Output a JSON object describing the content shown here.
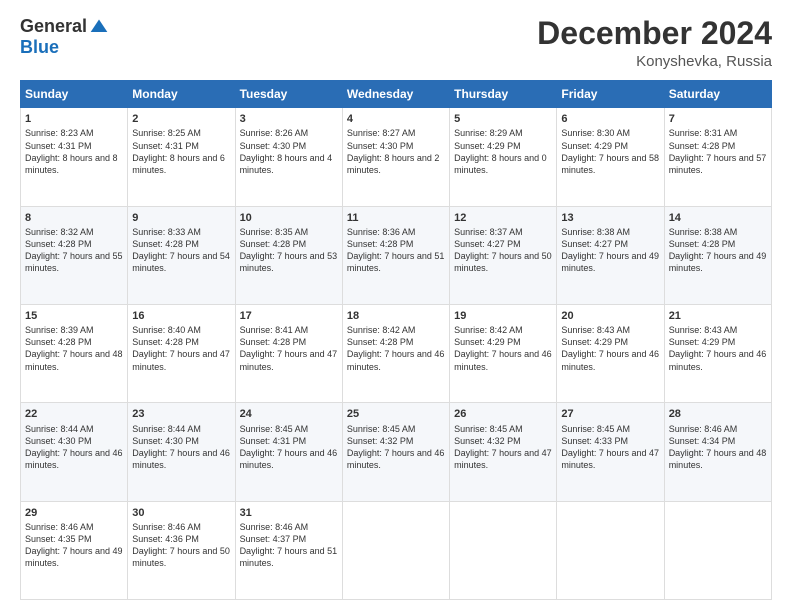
{
  "logo": {
    "general": "General",
    "blue": "Blue"
  },
  "title": {
    "month_year": "December 2024",
    "location": "Konyshevka, Russia"
  },
  "days_of_week": [
    "Sunday",
    "Monday",
    "Tuesday",
    "Wednesday",
    "Thursday",
    "Friday",
    "Saturday"
  ],
  "weeks": [
    [
      {
        "day": "1",
        "info": "Sunrise: 8:23 AM\nSunset: 4:31 PM\nDaylight: 8 hours\nand 8 minutes."
      },
      {
        "day": "2",
        "info": "Sunrise: 8:25 AM\nSunset: 4:31 PM\nDaylight: 8 hours\nand 6 minutes."
      },
      {
        "day": "3",
        "info": "Sunrise: 8:26 AM\nSunset: 4:30 PM\nDaylight: 8 hours\nand 4 minutes."
      },
      {
        "day": "4",
        "info": "Sunrise: 8:27 AM\nSunset: 4:30 PM\nDaylight: 8 hours\nand 2 minutes."
      },
      {
        "day": "5",
        "info": "Sunrise: 8:29 AM\nSunset: 4:29 PM\nDaylight: 8 hours\nand 0 minutes."
      },
      {
        "day": "6",
        "info": "Sunrise: 8:30 AM\nSunset: 4:29 PM\nDaylight: 7 hours\nand 58 minutes."
      },
      {
        "day": "7",
        "info": "Sunrise: 8:31 AM\nSunset: 4:28 PM\nDaylight: 7 hours\nand 57 minutes."
      }
    ],
    [
      {
        "day": "8",
        "info": "Sunrise: 8:32 AM\nSunset: 4:28 PM\nDaylight: 7 hours\nand 55 minutes."
      },
      {
        "day": "9",
        "info": "Sunrise: 8:33 AM\nSunset: 4:28 PM\nDaylight: 7 hours\nand 54 minutes."
      },
      {
        "day": "10",
        "info": "Sunrise: 8:35 AM\nSunset: 4:28 PM\nDaylight: 7 hours\nand 53 minutes."
      },
      {
        "day": "11",
        "info": "Sunrise: 8:36 AM\nSunset: 4:28 PM\nDaylight: 7 hours\nand 51 minutes."
      },
      {
        "day": "12",
        "info": "Sunrise: 8:37 AM\nSunset: 4:27 PM\nDaylight: 7 hours\nand 50 minutes."
      },
      {
        "day": "13",
        "info": "Sunrise: 8:38 AM\nSunset: 4:27 PM\nDaylight: 7 hours\nand 49 minutes."
      },
      {
        "day": "14",
        "info": "Sunrise: 8:38 AM\nSunset: 4:28 PM\nDaylight: 7 hours\nand 49 minutes."
      }
    ],
    [
      {
        "day": "15",
        "info": "Sunrise: 8:39 AM\nSunset: 4:28 PM\nDaylight: 7 hours\nand 48 minutes."
      },
      {
        "day": "16",
        "info": "Sunrise: 8:40 AM\nSunset: 4:28 PM\nDaylight: 7 hours\nand 47 minutes."
      },
      {
        "day": "17",
        "info": "Sunrise: 8:41 AM\nSunset: 4:28 PM\nDaylight: 7 hours\nand 47 minutes."
      },
      {
        "day": "18",
        "info": "Sunrise: 8:42 AM\nSunset: 4:28 PM\nDaylight: 7 hours\nand 46 minutes."
      },
      {
        "day": "19",
        "info": "Sunrise: 8:42 AM\nSunset: 4:29 PM\nDaylight: 7 hours\nand 46 minutes."
      },
      {
        "day": "20",
        "info": "Sunrise: 8:43 AM\nSunset: 4:29 PM\nDaylight: 7 hours\nand 46 minutes."
      },
      {
        "day": "21",
        "info": "Sunrise: 8:43 AM\nSunset: 4:29 PM\nDaylight: 7 hours\nand 46 minutes."
      }
    ],
    [
      {
        "day": "22",
        "info": "Sunrise: 8:44 AM\nSunset: 4:30 PM\nDaylight: 7 hours\nand 46 minutes."
      },
      {
        "day": "23",
        "info": "Sunrise: 8:44 AM\nSunset: 4:30 PM\nDaylight: 7 hours\nand 46 minutes."
      },
      {
        "day": "24",
        "info": "Sunrise: 8:45 AM\nSunset: 4:31 PM\nDaylight: 7 hours\nand 46 minutes."
      },
      {
        "day": "25",
        "info": "Sunrise: 8:45 AM\nSunset: 4:32 PM\nDaylight: 7 hours\nand 46 minutes."
      },
      {
        "day": "26",
        "info": "Sunrise: 8:45 AM\nSunset: 4:32 PM\nDaylight: 7 hours\nand 47 minutes."
      },
      {
        "day": "27",
        "info": "Sunrise: 8:45 AM\nSunset: 4:33 PM\nDaylight: 7 hours\nand 47 minutes."
      },
      {
        "day": "28",
        "info": "Sunrise: 8:46 AM\nSunset: 4:34 PM\nDaylight: 7 hours\nand 48 minutes."
      }
    ],
    [
      {
        "day": "29",
        "info": "Sunrise: 8:46 AM\nSunset: 4:35 PM\nDaylight: 7 hours\nand 49 minutes."
      },
      {
        "day": "30",
        "info": "Sunrise: 8:46 AM\nSunset: 4:36 PM\nDaylight: 7 hours\nand 50 minutes."
      },
      {
        "day": "31",
        "info": "Sunrise: 8:46 AM\nSunset: 4:37 PM\nDaylight: 7 hours\nand 51 minutes."
      },
      {
        "day": "",
        "info": ""
      },
      {
        "day": "",
        "info": ""
      },
      {
        "day": "",
        "info": ""
      },
      {
        "day": "",
        "info": ""
      }
    ]
  ]
}
